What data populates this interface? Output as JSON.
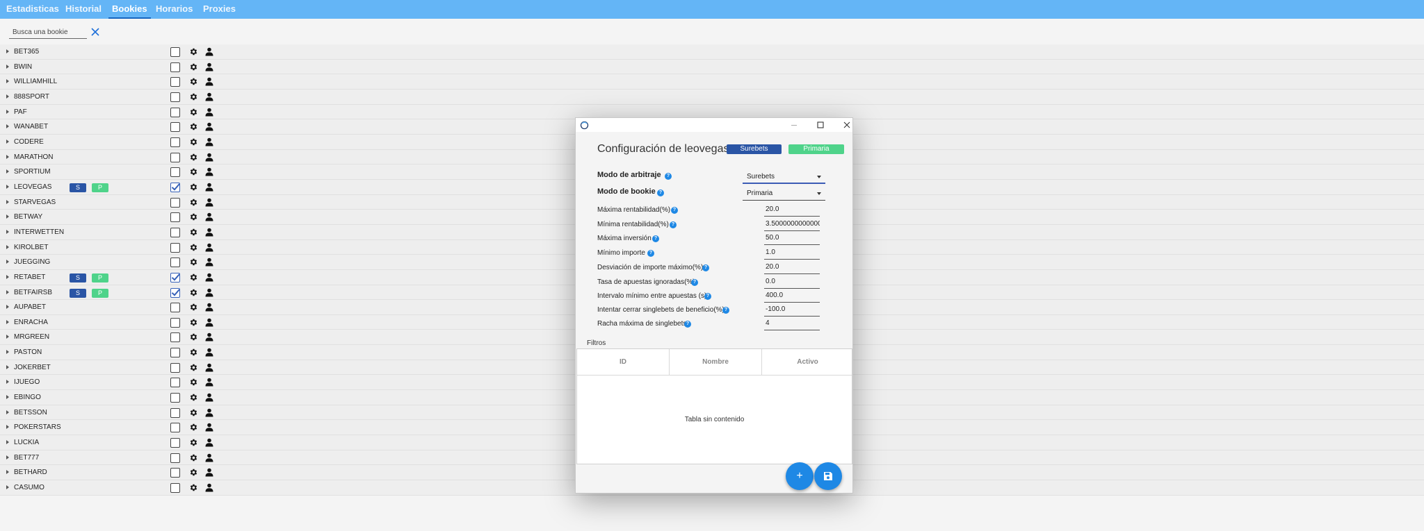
{
  "tabs": [
    {
      "label": "Estadisticas",
      "active": false
    },
    {
      "label": "Historial",
      "active": false
    },
    {
      "label": "Bookies",
      "active": true
    },
    {
      "label": "Horarios",
      "active": false
    },
    {
      "label": "Proxies",
      "active": false
    }
  ],
  "search": {
    "placeholder": "Busca una bookie",
    "value": ""
  },
  "bookies": [
    {
      "name": "BET365",
      "checked": false,
      "badges": []
    },
    {
      "name": "BWIN",
      "checked": false,
      "badges": []
    },
    {
      "name": "WILLIAMHILL",
      "checked": false,
      "badges": []
    },
    {
      "name": "888SPORT",
      "checked": false,
      "badges": []
    },
    {
      "name": "PAF",
      "checked": false,
      "badges": []
    },
    {
      "name": "WANABET",
      "checked": false,
      "badges": []
    },
    {
      "name": "CODERE",
      "checked": false,
      "badges": []
    },
    {
      "name": "MARATHON",
      "checked": false,
      "badges": []
    },
    {
      "name": "SPORTIUM",
      "checked": false,
      "badges": []
    },
    {
      "name": "LEOVEGAS",
      "checked": true,
      "badges": [
        "S",
        "P"
      ]
    },
    {
      "name": "STARVEGAS",
      "checked": false,
      "badges": []
    },
    {
      "name": "BETWAY",
      "checked": false,
      "badges": []
    },
    {
      "name": "INTERWETTEN",
      "checked": false,
      "badges": []
    },
    {
      "name": "KIROLBET",
      "checked": false,
      "badges": []
    },
    {
      "name": "JUEGGING",
      "checked": false,
      "badges": []
    },
    {
      "name": "RETABET",
      "checked": true,
      "badges": [
        "S",
        "P"
      ]
    },
    {
      "name": "BETFAIRSB",
      "checked": true,
      "badges": [
        "S",
        "P"
      ]
    },
    {
      "name": "AUPABET",
      "checked": false,
      "badges": []
    },
    {
      "name": "ENRACHA",
      "checked": false,
      "badges": []
    },
    {
      "name": "MRGREEN",
      "checked": false,
      "badges": []
    },
    {
      "name": "PASTON",
      "checked": false,
      "badges": []
    },
    {
      "name": "JOKERBET",
      "checked": false,
      "badges": []
    },
    {
      "name": "IJUEGO",
      "checked": false,
      "badges": []
    },
    {
      "name": "EBINGO",
      "checked": false,
      "badges": []
    },
    {
      "name": "BETSSON",
      "checked": false,
      "badges": []
    },
    {
      "name": "POKERSTARS",
      "checked": false,
      "badges": []
    },
    {
      "name": "LUCKIA",
      "checked": false,
      "badges": []
    },
    {
      "name": "BET777",
      "checked": false,
      "badges": []
    },
    {
      "name": "BETHARD",
      "checked": false,
      "badges": []
    },
    {
      "name": "CASUMO",
      "checked": false,
      "badges": []
    }
  ],
  "colors": {
    "accent": "#64b5f6",
    "badge_s": "#2a55a5",
    "badge_p": "#4fd38a",
    "fab": "#1e88e5"
  },
  "dialog": {
    "title": "Configuración de leovegas",
    "pill_s": "Surebets",
    "pill_p": "Primaria",
    "help_glyph": "?",
    "modo_arbitraje_label": "Modo de arbitraje",
    "modo_arbitraje_value": "Surebets",
    "modo_bookie_label": "Modo de bookie",
    "modo_bookie_value": "Primaria",
    "fields": [
      {
        "label": "Máxima rentabilidad(%)",
        "value": "20.0"
      },
      {
        "label": "Mínima rentabilidad(%)",
        "value": "3.50000000000000"
      },
      {
        "label": "Máxima inversión",
        "value": "50.0"
      },
      {
        "label": "Mínimo importe",
        "value": "1.0"
      },
      {
        "label": "Desviación de importe máximo(%)",
        "value": "20.0"
      },
      {
        "label": "Tasa de apuestas ignoradas(%)",
        "value": "0.0"
      },
      {
        "label": "Intervalo mínimo entre apuestas (s)",
        "value": "400.0"
      },
      {
        "label": "Intentar cerrar singlebets de beneficio(%)",
        "value": "-100.0"
      },
      {
        "label": "Racha máxima de singlebets",
        "value": "4"
      }
    ],
    "filters_label": "Filtros",
    "table_headers": [
      "ID",
      "Nombre",
      "Activo"
    ],
    "empty_text": "Tabla sin contenido",
    "add_glyph": "+"
  }
}
